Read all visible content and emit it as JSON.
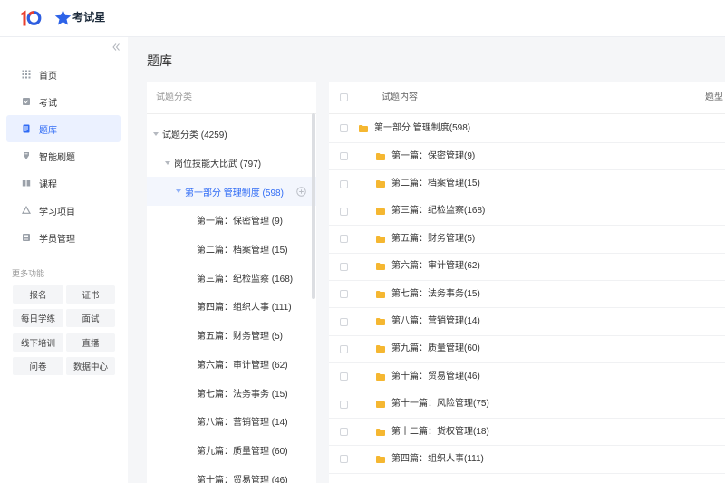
{
  "header": {
    "logo_icon": "brand-10-logo",
    "brand_icon": "star-logo-icon",
    "brand_name": "考试星"
  },
  "sidebar": {
    "collapse_icon": "double-chevron-left-icon",
    "items": [
      {
        "label": "首页",
        "icon": "grid-icon"
      },
      {
        "label": "考试",
        "icon": "exam-icon"
      },
      {
        "label": "题库",
        "icon": "question-bank-icon",
        "active": true
      },
      {
        "label": "智能刷题",
        "icon": "smart-practice-icon"
      },
      {
        "label": "课程",
        "icon": "course-book-icon"
      },
      {
        "label": "学习项目",
        "icon": "learning-project-icon"
      },
      {
        "label": "学员管理",
        "icon": "student-card-icon"
      }
    ],
    "more_title": "更多功能",
    "more_buttons": [
      "报名",
      "证书",
      "每日学练",
      "面试",
      "线下培训",
      "直播",
      "问卷",
      "数据中心"
    ]
  },
  "page_title": "题库",
  "tree": {
    "header": "试题分类",
    "add_icon": "plus-circle-icon",
    "root": {
      "label": "试题分类 (4259)",
      "expanded": true,
      "child": {
        "label": "岗位技能大比武 (797)",
        "expanded": true,
        "child": {
          "label": "第一部分 管理制度 (598)",
          "expanded": true,
          "selected": true,
          "children": [
            "第一篇：保密管理 (9)",
            "第二篇：档案管理 (15)",
            "第三篇：纪检监察 (168)",
            "第四篇：组织人事 (111)",
            "第五篇：财务管理 (5)",
            "第六篇：审计管理 (62)",
            "第七篇：法务事务 (15)",
            "第八篇：营销管理 (14)",
            "第九篇：质量管理 (60)",
            "第十篇：贸易管理 (46)"
          ]
        }
      }
    }
  },
  "table": {
    "columns": {
      "content": "试题内容",
      "type": "题型"
    },
    "select_all_checked": false,
    "row_icon": "folder-icon",
    "folder_row": "第一部分 管理制度(598)",
    "subfolder_rows": [
      "第一篇：保密管理(9)",
      "第二篇：档案管理(15)",
      "第三篇：纪检监察(168)",
      "第五篇：财务管理(5)",
      "第六篇：审计管理(62)",
      "第七篇：法务事务(15)",
      "第八篇：营销管理(14)",
      "第九篇：质量管理(60)",
      "第十篇：贸易管理(46)",
      "第十一篇：风险管理(75)",
      "第十二篇：货权管理(18)",
      "第四篇：组织人事(111)"
    ]
  },
  "colors": {
    "accent": "#2f6bf5",
    "active_bg": "#ebf1ff",
    "folder": "#f5b731",
    "page_bg": "#f5f6f8",
    "logo_red": "#e8402f",
    "logo_blue": "#2d5de0"
  }
}
